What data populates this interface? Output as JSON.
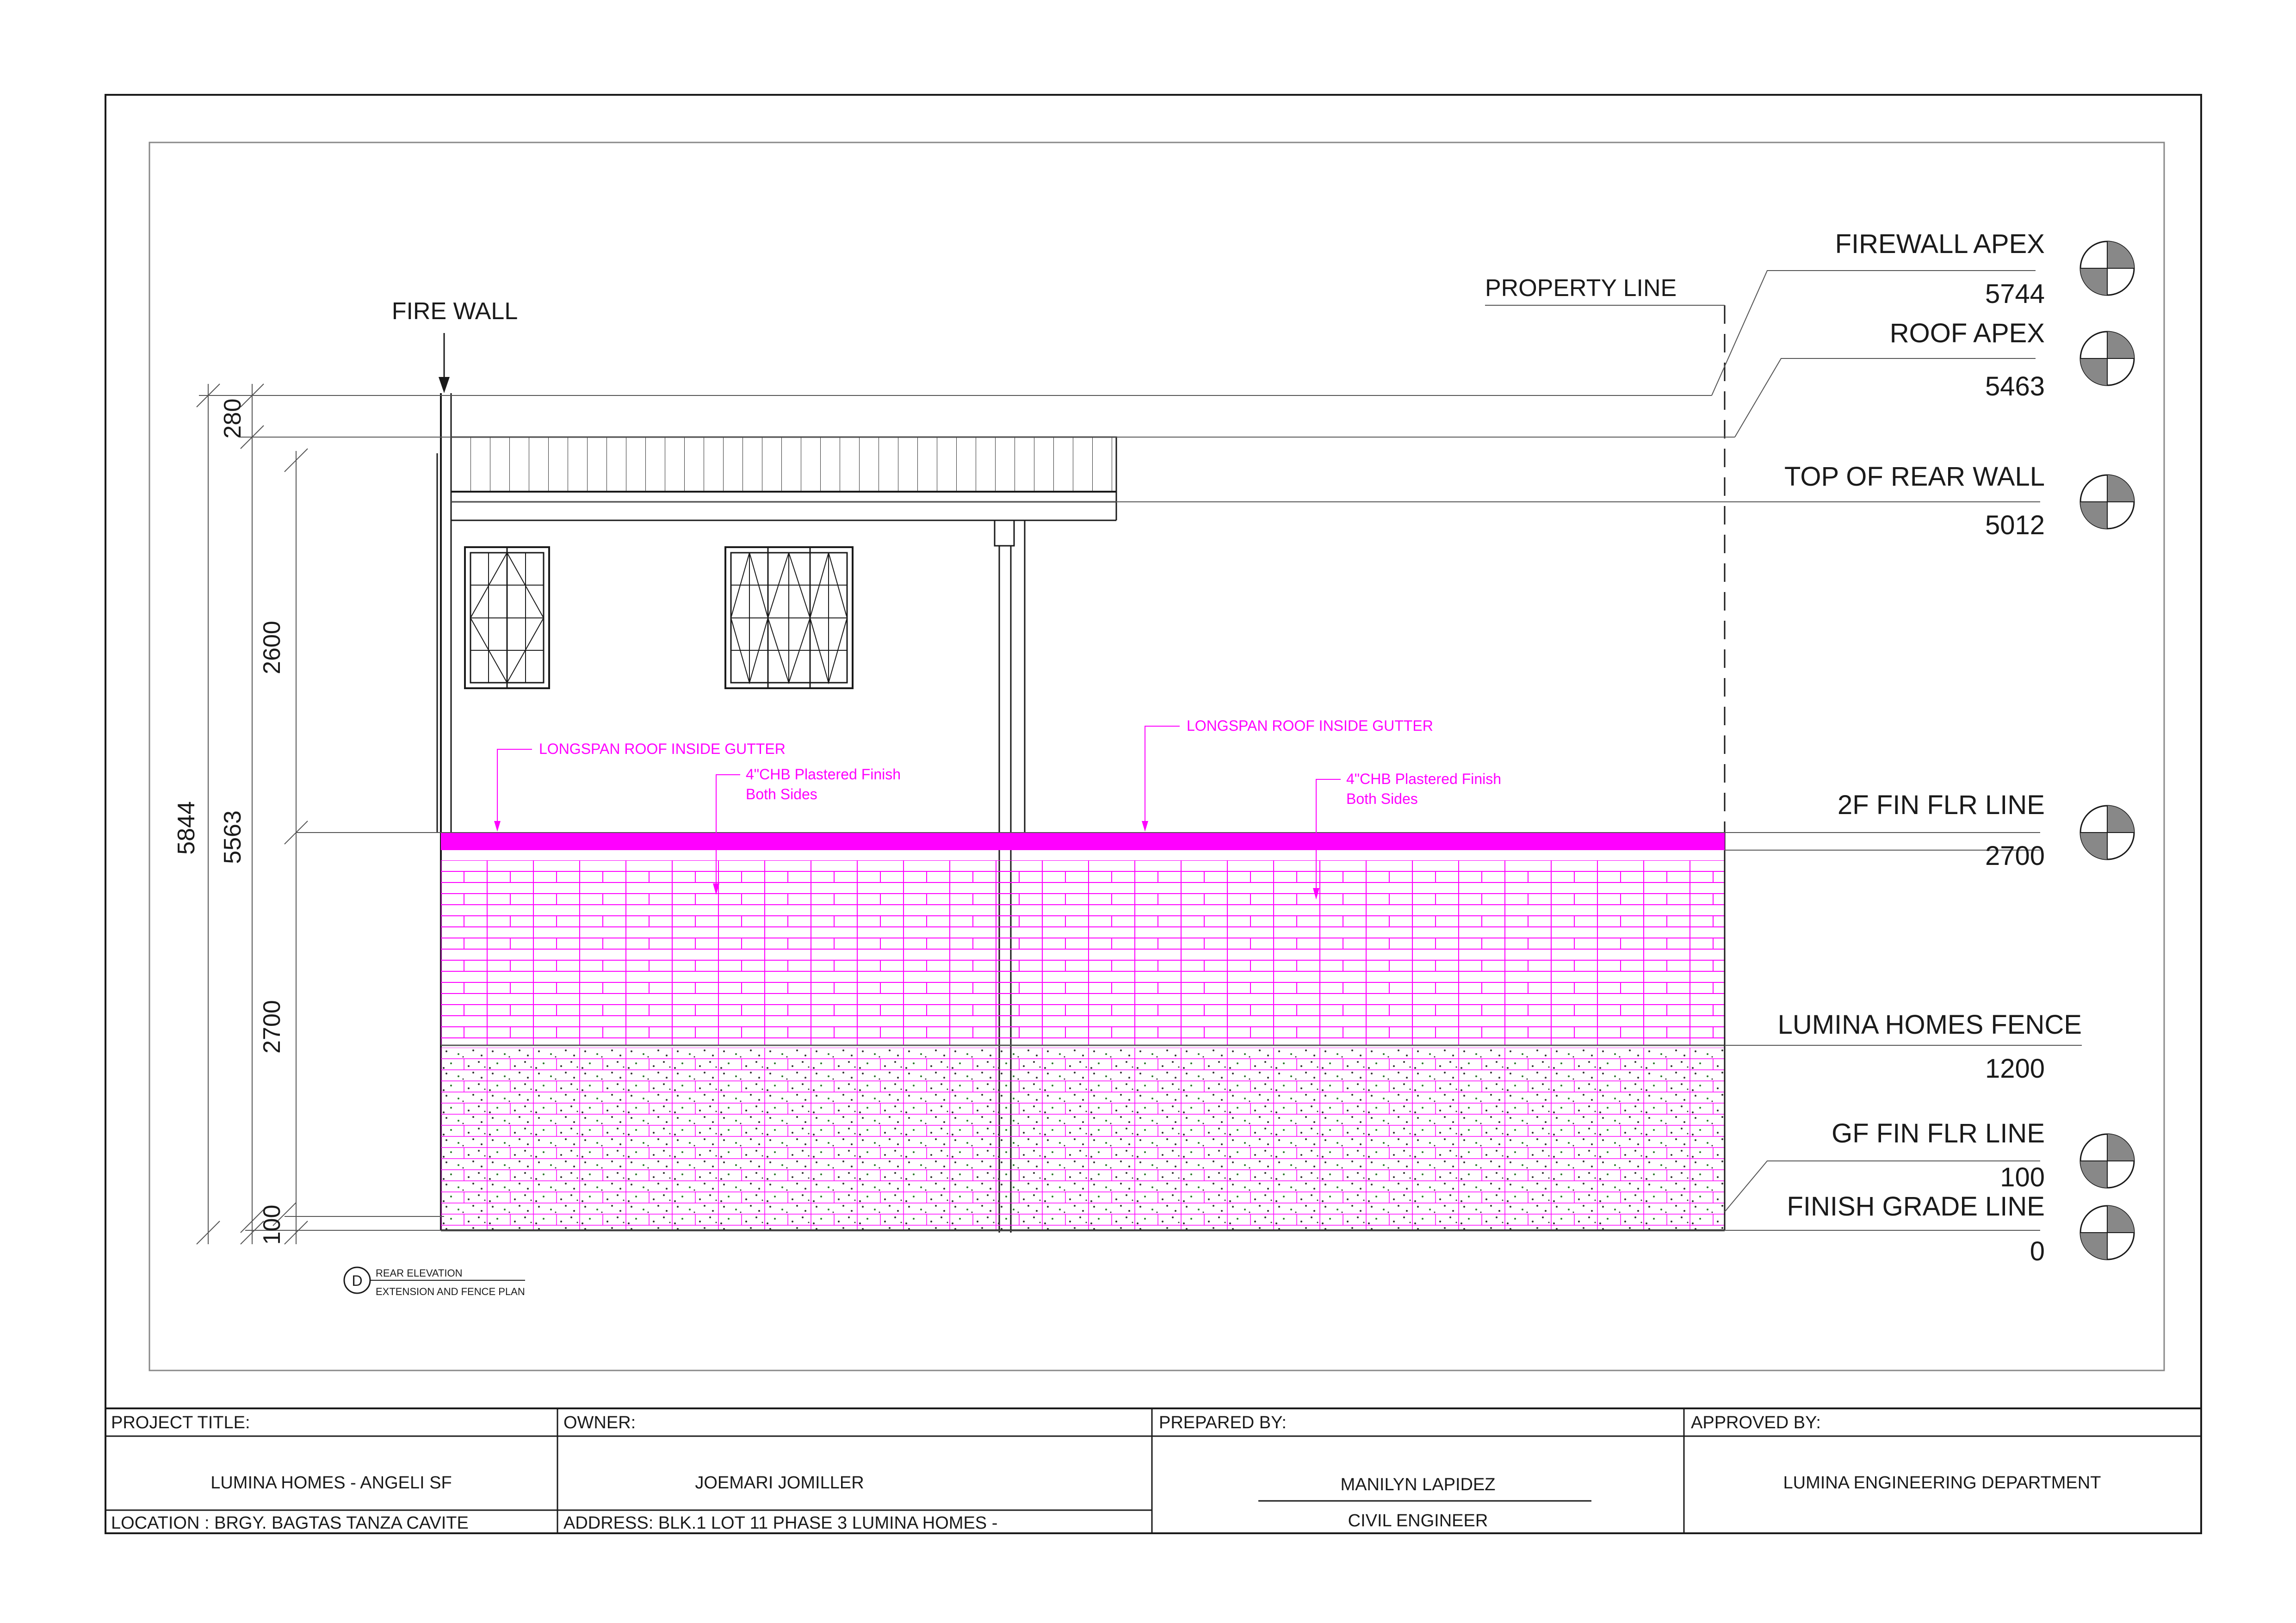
{
  "labels": {
    "fire_wall": "FIRE WALL",
    "property_line": "PROPERTY LINE",
    "gutter_left": "LONGSPAN ROOF INSIDE GUTTER",
    "gutter_right": "LONGSPAN ROOF INSIDE GUTTER",
    "chb_left_1": "4\"CHB Plastered Finish",
    "chb_left_2": "Both Sides",
    "chb_right_1": "4\"CHB Plastered Finish",
    "chb_right_2": "Both Sides"
  },
  "levels": [
    {
      "name": "FIREWALL APEX",
      "value": "5744"
    },
    {
      "name": "ROOF APEX",
      "value": "5463"
    },
    {
      "name": "TOP OF REAR WALL",
      "value": "5012"
    },
    {
      "name": "2F FIN FLR LINE",
      "value": "2700"
    },
    {
      "name": "LUMINA HOMES FENCE",
      "value": "1200"
    },
    {
      "name": "GF FIN FLR LINE",
      "value": "100"
    },
    {
      "name": "FINISH GRADE LINE",
      "value": "0"
    }
  ],
  "dimensions": {
    "overall": "5844",
    "secondary": "5563",
    "d280": "280",
    "d2600": "2600",
    "d2700": "2700",
    "d100": "100"
  },
  "callout": {
    "letter": "D",
    "title": "REAR ELEVATION",
    "subtitle": "EXTENSION AND FENCE PLAN"
  },
  "title_block": {
    "project_title_label": "PROJECT TITLE:",
    "project_title": "LUMINA HOMES - ANGELI SF",
    "location": "LOCATION :   BRGY. BAGTAS TANZA CAVITE",
    "owner_label": "OWNER:",
    "owner": "JOEMARI JOMILLER",
    "address": "ADDRESS: BLK.1 LOT 11 PHASE 3 LUMINA HOMES   -",
    "prepared_label": "PREPARED BY:",
    "prepared_name": "MANILYN LAPIDEZ",
    "prepared_role": "CIVIL ENGINEER",
    "approved_label": "APPROVED BY:",
    "approved": "LUMINA ENGINEERING DEPARTMENT"
  },
  "colors": {
    "magenta": "#ff00ff",
    "line": "#1a1a1a"
  }
}
